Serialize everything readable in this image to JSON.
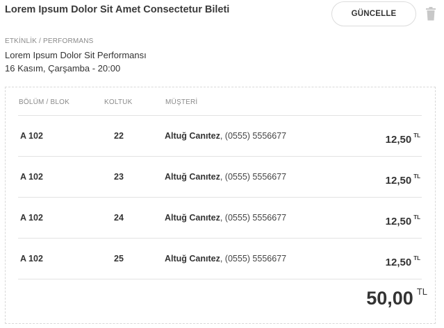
{
  "ticket": {
    "title": "Lorem Ipsum Dolor Sit Amet Consectetur Bileti",
    "update_label": "GÜNCELLE"
  },
  "event": {
    "label": "ETKİNLİK / PERFORMANS",
    "name": "Lorem Ipsum Dolor Sit Performansı",
    "date": "16 Kasım, Çarşamba - 20:00"
  },
  "table": {
    "headers": {
      "block": "BÖLÜM / BLOK",
      "seat": "KOLTUK",
      "customer": "MÜŞTERİ"
    },
    "rows": [
      {
        "block": "A 102",
        "seat": "22",
        "customer_name": "Altuğ Canıtez",
        "customer_phone": ", (0555) 5556677",
        "price": "12,50",
        "currency": "TL"
      },
      {
        "block": "A 102",
        "seat": "23",
        "customer_name": "Altuğ Canıtez",
        "customer_phone": ", (0555) 5556677",
        "price": "12,50",
        "currency": "TL"
      },
      {
        "block": "A 102",
        "seat": "24",
        "customer_name": "Altuğ Canıtez",
        "customer_phone": ", (0555) 5556677",
        "price": "12,50",
        "currency": "TL"
      },
      {
        "block": "A 102",
        "seat": "25",
        "customer_name": "Altuğ Canıtez",
        "customer_phone": ", (0555) 5556677",
        "price": "12,50",
        "currency": "TL"
      }
    ]
  },
  "total": {
    "amount": "50,00",
    "currency": "TL"
  },
  "icons": {
    "delete": "trash-icon"
  },
  "colors": {
    "text": "#333333",
    "muted": "#8a8a8a",
    "border": "#dcdcdc"
  }
}
